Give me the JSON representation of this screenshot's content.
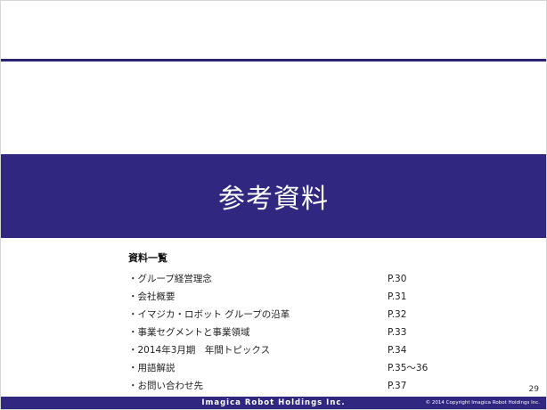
{
  "slide": {
    "title": "参考資料",
    "page_number": "29"
  },
  "toc": {
    "heading": "資料一覧",
    "items": [
      {
        "label": "・グループ経営理念",
        "page": "P.30"
      },
      {
        "label": "・会社概要",
        "page": "P.31"
      },
      {
        "label": "・イマジカ・ロボット グループの沿革",
        "page": "P.32"
      },
      {
        "label": "・事業セグメントと事業領域",
        "page": "P.33"
      },
      {
        "label": "・2014年3月期　年間トピックス",
        "page": "P.34"
      },
      {
        "label": "・用語解説",
        "page": "P.35～36"
      },
      {
        "label": "・お問い合わせ先",
        "page": "P.37"
      }
    ]
  },
  "footer": {
    "company": "Imagica Robot Holdings Inc.",
    "copyright": "© 2014 Copyright Imagica Robot Holdings Inc."
  },
  "colors": {
    "brand": "#2f2780",
    "rule": "#2a2370"
  }
}
